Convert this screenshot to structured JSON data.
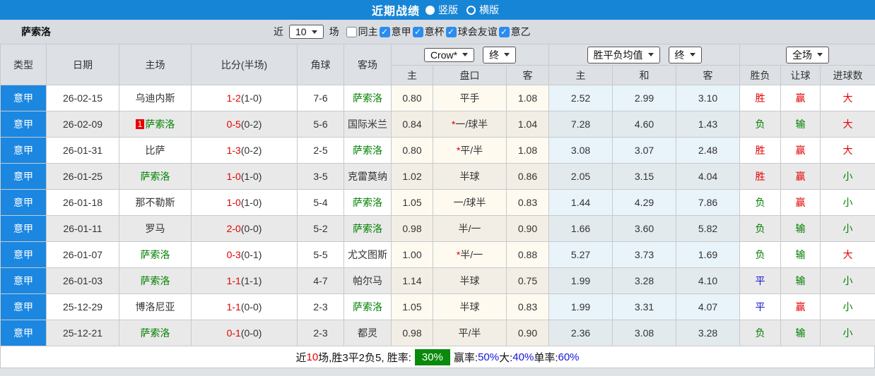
{
  "title_bar": {
    "title": "近期战绩",
    "radios": [
      {
        "label": "竖版",
        "state": "sel"
      },
      {
        "label": "横版",
        "state": "unsel"
      }
    ]
  },
  "filter_bar": {
    "team": "萨索洛",
    "near_label": "近",
    "count_value": "10",
    "games_label": "场",
    "checkboxes": [
      {
        "label": "同主",
        "state": "unchecked"
      },
      {
        "label": "意甲",
        "state": "checked"
      },
      {
        "label": "意杯",
        "state": "checked"
      },
      {
        "label": "球会友谊",
        "state": "checked"
      },
      {
        "label": "意乙",
        "state": "checked"
      }
    ]
  },
  "table": {
    "selects": {
      "bookmaker": "Crow*",
      "bookmaker_time": "终",
      "odds_type": "胜平负均值",
      "odds_time": "终",
      "scope": "全场"
    },
    "headers": {
      "type": "类型",
      "date": "日期",
      "home": "主场",
      "score": "比分(半场)",
      "corner": "角球",
      "away": "客场",
      "sub": [
        "主",
        "盘口",
        "客",
        "主",
        "和",
        "客",
        "胜负",
        "让球",
        "进球数"
      ]
    },
    "rows": [
      {
        "league": "意甲",
        "date": "26-02-15",
        "badge": "",
        "home": "乌迪内斯",
        "home_cls": "",
        "score": "1-2",
        "half": "(1-0)",
        "corner": "7-6",
        "away": "萨索洛",
        "away_cls": "green",
        "odds_home": "0.80",
        "star": "",
        "handicap": "平手",
        "odds_away": "1.08",
        "avg_win": "2.52",
        "avg_draw": "2.99",
        "avg_lose": "3.10",
        "result": "胜",
        "result_cls": "red",
        "covers": "赢",
        "covers_cls": "red",
        "goals": "大",
        "goals_cls": "red"
      },
      {
        "league": "意甲",
        "date": "26-02-09",
        "badge": "1",
        "home": "萨索洛",
        "home_cls": "green",
        "score": "0-5",
        "half": "(0-2)",
        "corner": "5-6",
        "away": "国际米兰",
        "away_cls": "",
        "odds_home": "0.84",
        "star": "*",
        "handicap": "一/球半",
        "odds_away": "1.04",
        "avg_win": "7.28",
        "avg_draw": "4.60",
        "avg_lose": "1.43",
        "result": "负",
        "result_cls": "green",
        "covers": "输",
        "covers_cls": "green",
        "goals": "大",
        "goals_cls": "red"
      },
      {
        "league": "意甲",
        "date": "26-01-31",
        "badge": "",
        "home": "比萨",
        "home_cls": "",
        "score": "1-3",
        "half": "(0-2)",
        "corner": "2-5",
        "away": "萨索洛",
        "away_cls": "green",
        "odds_home": "0.80",
        "star": "*",
        "handicap": "平/半",
        "odds_away": "1.08",
        "avg_win": "3.08",
        "avg_draw": "3.07",
        "avg_lose": "2.48",
        "result": "胜",
        "result_cls": "red",
        "covers": "赢",
        "covers_cls": "red",
        "goals": "大",
        "goals_cls": "red"
      },
      {
        "league": "意甲",
        "date": "26-01-25",
        "badge": "",
        "home": "萨索洛",
        "home_cls": "green",
        "score": "1-0",
        "half": "(1-0)",
        "corner": "3-5",
        "away": "克雷莫纳",
        "away_cls": "",
        "odds_home": "1.02",
        "star": "",
        "handicap": "半球",
        "odds_away": "0.86",
        "avg_win": "2.05",
        "avg_draw": "3.15",
        "avg_lose": "4.04",
        "result": "胜",
        "result_cls": "red",
        "covers": "赢",
        "covers_cls": "red",
        "goals": "小",
        "goals_cls": "green"
      },
      {
        "league": "意甲",
        "date": "26-01-18",
        "badge": "",
        "home": "那不勒斯",
        "home_cls": "",
        "score": "1-0",
        "half": "(1-0)",
        "corner": "5-4",
        "away": "萨索洛",
        "away_cls": "green",
        "odds_home": "1.05",
        "star": "",
        "handicap": "一/球半",
        "odds_away": "0.83",
        "avg_win": "1.44",
        "avg_draw": "4.29",
        "avg_lose": "7.86",
        "result": "负",
        "result_cls": "green",
        "covers": "赢",
        "covers_cls": "red",
        "goals": "小",
        "goals_cls": "green"
      },
      {
        "league": "意甲",
        "date": "26-01-11",
        "badge": "",
        "home": "罗马",
        "home_cls": "",
        "score": "2-0",
        "half": "(0-0)",
        "corner": "5-2",
        "away": "萨索洛",
        "away_cls": "green",
        "odds_home": "0.98",
        "star": "",
        "handicap": "半/一",
        "odds_away": "0.90",
        "avg_win": "1.66",
        "avg_draw": "3.60",
        "avg_lose": "5.82",
        "result": "负",
        "result_cls": "green",
        "covers": "输",
        "covers_cls": "green",
        "goals": "小",
        "goals_cls": "green"
      },
      {
        "league": "意甲",
        "date": "26-01-07",
        "badge": "",
        "home": "萨索洛",
        "home_cls": "green",
        "score": "0-3",
        "half": "(0-1)",
        "corner": "5-5",
        "away": "尤文图斯",
        "away_cls": "",
        "odds_home": "1.00",
        "star": "*",
        "handicap": "半/一",
        "odds_away": "0.88",
        "avg_win": "5.27",
        "avg_draw": "3.73",
        "avg_lose": "1.69",
        "result": "负",
        "result_cls": "green",
        "covers": "输",
        "covers_cls": "green",
        "goals": "大",
        "goals_cls": "red"
      },
      {
        "league": "意甲",
        "date": "26-01-03",
        "badge": "",
        "home": "萨索洛",
        "home_cls": "green",
        "score": "1-1",
        "half": "(1-1)",
        "corner": "4-7",
        "away": "帕尔马",
        "away_cls": "",
        "odds_home": "1.14",
        "star": "",
        "handicap": "半球",
        "odds_away": "0.75",
        "avg_win": "1.99",
        "avg_draw": "3.28",
        "avg_lose": "4.10",
        "result": "平",
        "result_cls": "blue",
        "covers": "输",
        "covers_cls": "green",
        "goals": "小",
        "goals_cls": "green"
      },
      {
        "league": "意甲",
        "date": "25-12-29",
        "badge": "",
        "home": "博洛尼亚",
        "home_cls": "",
        "score": "1-1",
        "half": "(0-0)",
        "corner": "2-3",
        "away": "萨索洛",
        "away_cls": "green",
        "odds_home": "1.05",
        "star": "",
        "handicap": "半球",
        "odds_away": "0.83",
        "avg_win": "1.99",
        "avg_draw": "3.31",
        "avg_lose": "4.07",
        "result": "平",
        "result_cls": "blue",
        "covers": "赢",
        "covers_cls": "red",
        "goals": "小",
        "goals_cls": "green"
      },
      {
        "league": "意甲",
        "date": "25-12-21",
        "badge": "",
        "home": "萨索洛",
        "home_cls": "green",
        "score": "0-1",
        "half": "(0-0)",
        "corner": "2-3",
        "away": "都灵",
        "away_cls": "",
        "odds_home": "0.98",
        "star": "",
        "handicap": "平/半",
        "odds_away": "0.90",
        "avg_win": "2.36",
        "avg_draw": "3.08",
        "avg_lose": "3.28",
        "result": "负",
        "result_cls": "green",
        "covers": "输",
        "covers_cls": "green",
        "goals": "小",
        "goals_cls": "green"
      }
    ]
  },
  "footer": {
    "segments": [
      {
        "text": "近",
        "cls": "k"
      },
      {
        "text": "10",
        "cls": "red"
      },
      {
        "text": "场,胜3平2负5, 胜率:",
        "cls": "k"
      },
      {
        "text": "30%",
        "cls": "pct"
      },
      {
        "text": "赢率:",
        "cls": "k"
      },
      {
        "text": "50%",
        "cls": "blue"
      },
      {
        "text": " 大:",
        "cls": "k"
      },
      {
        "text": "40%",
        "cls": "blue"
      },
      {
        "text": " 单率:",
        "cls": "k"
      },
      {
        "text": "60%",
        "cls": "blue"
      }
    ]
  },
  "colors": {
    "accent_blue": "#1785d6",
    "league_cell_blue": "#1b87e0",
    "win_red": "#e60000",
    "lose_green": "#008000",
    "draw_blue": "#1414d2",
    "rate_badge_green": "#0a8a0a",
    "checkbox_blue": "#2b8cf0"
  }
}
